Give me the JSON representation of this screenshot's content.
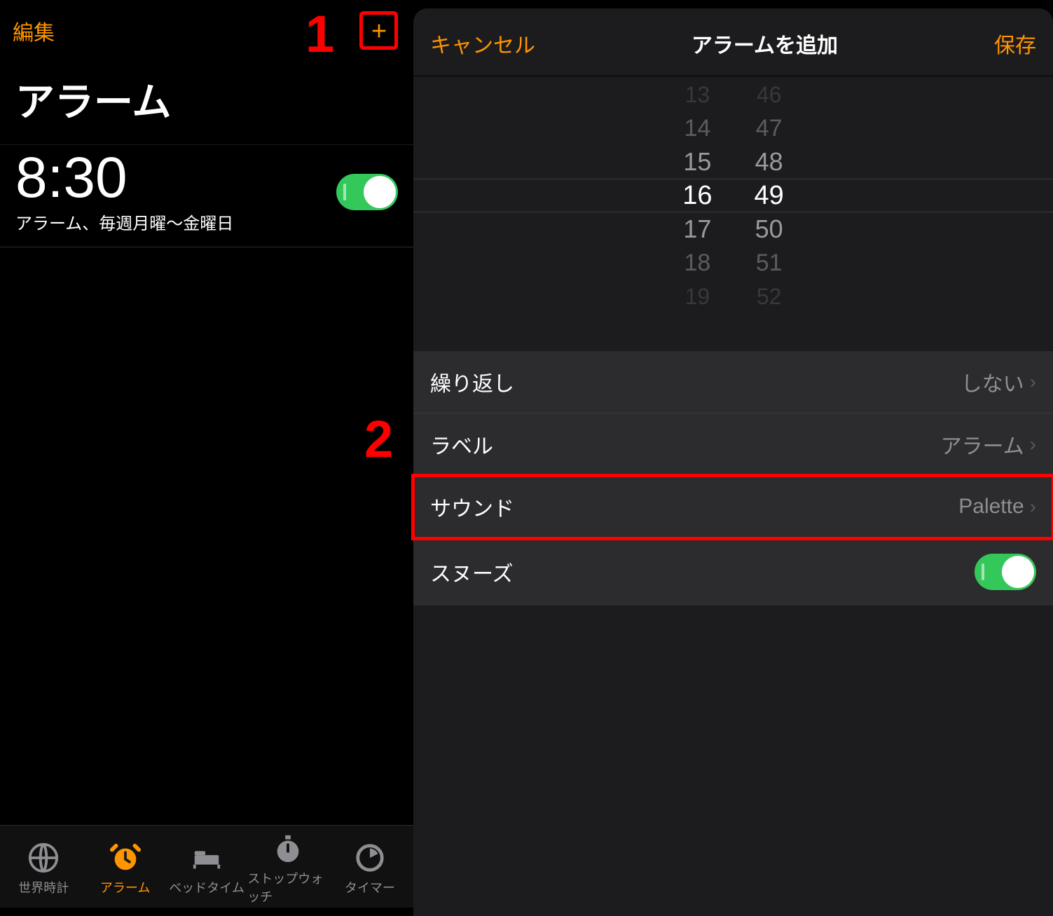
{
  "colors": {
    "accent": "#ff9500",
    "switchOn": "#34c759",
    "secondaryText": "#8e8e93"
  },
  "annotations": {
    "one": "1",
    "two": "2"
  },
  "left": {
    "edit": "編集",
    "title": "アラーム",
    "alarm": {
      "time": "8:30",
      "sub": "アラーム、毎週月曜〜金曜日",
      "enabled": true
    },
    "tabs": [
      {
        "label": "世界時計"
      },
      {
        "label": "アラーム"
      },
      {
        "label": "ベッドタイム"
      },
      {
        "label": "ストップウォッチ"
      },
      {
        "label": "タイマー"
      }
    ]
  },
  "right": {
    "cancel": "キャンセル",
    "title": "アラームを追加",
    "save": "保存",
    "picker": {
      "hours": [
        "13",
        "14",
        "15",
        "16",
        "17",
        "18",
        "19"
      ],
      "minutes": [
        "46",
        "47",
        "48",
        "49",
        "50",
        "51",
        "52"
      ]
    },
    "settings": {
      "repeat": {
        "label": "繰り返し",
        "value": "しない"
      },
      "label": {
        "label": "ラベル",
        "value": "アラーム"
      },
      "sound": {
        "label": "サウンド",
        "value": "Palette"
      },
      "snooze": {
        "label": "スヌーズ",
        "on": true
      }
    }
  }
}
